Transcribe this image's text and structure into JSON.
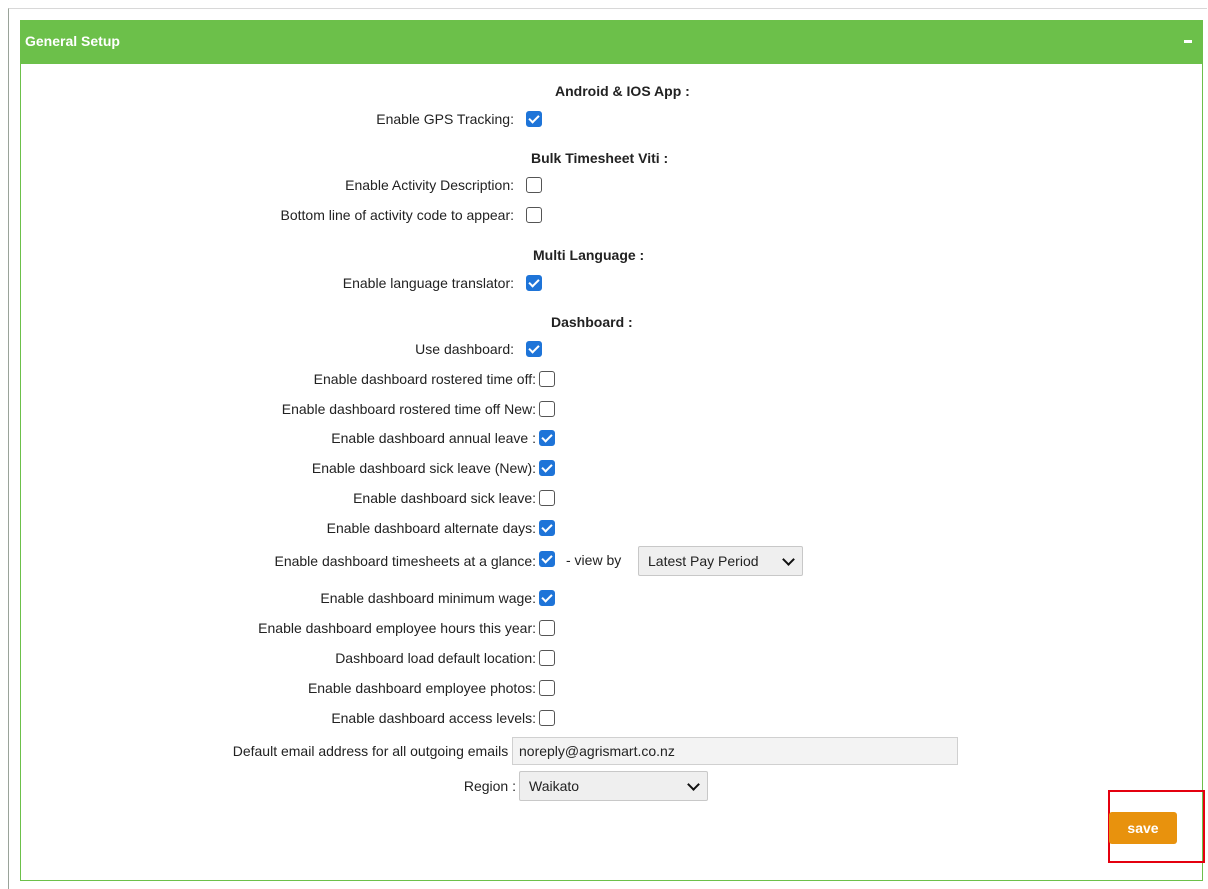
{
  "panel": {
    "title": "General Setup",
    "collapse": "−"
  },
  "sections": {
    "app": "Android & IOS App :",
    "bulk": "Bulk Timesheet Viti :",
    "language": "Multi Language :",
    "dashboard": "Dashboard :"
  },
  "fields": {
    "gps": {
      "label": "Enable GPS Tracking:",
      "checked": true
    },
    "activity_desc": {
      "label": "Enable Activity Description:",
      "checked": false
    },
    "bottom_line": {
      "label": "Bottom line of activity code to appear:",
      "checked": false
    },
    "translator": {
      "label": "Enable language translator:",
      "checked": true
    },
    "use_dashboard": {
      "label": "Use dashboard:",
      "checked": true
    },
    "rostered": {
      "label": "Enable dashboard rostered time off:",
      "checked": false
    },
    "rostered_new": {
      "label": "Enable dashboard rostered time off New:",
      "checked": false
    },
    "annual": {
      "label": "Enable dashboard annual leave :",
      "checked": true
    },
    "sick_new": {
      "label": "Enable dashboard sick leave (New):",
      "checked": true
    },
    "sick": {
      "label": "Enable dashboard sick leave:",
      "checked": false
    },
    "alternate": {
      "label": "Enable dashboard alternate days:",
      "checked": true
    },
    "glance": {
      "label": "Enable dashboard timesheets at a glance:",
      "checked": true,
      "view_by_label": "- view by",
      "view_by_value": "Latest Pay Period"
    },
    "min_wage": {
      "label": "Enable dashboard minimum wage:",
      "checked": true
    },
    "emp_hours": {
      "label": "Enable dashboard employee hours this year:",
      "checked": false
    },
    "default_loc": {
      "label": "Dashboard load default location:",
      "checked": false
    },
    "emp_photos": {
      "label": "Enable dashboard employee photos:",
      "checked": false
    },
    "access_levels": {
      "label": "Enable dashboard access levels:",
      "checked": false
    },
    "email": {
      "label": "Default email address for all outgoing emails :",
      "value": "noreply@agrismart.co.nz"
    },
    "region": {
      "label": "Region :",
      "value": "Waikato"
    }
  },
  "save_label": "save",
  "colors": {
    "header": "#6cc04a",
    "checkbox_on": "#1e74d8",
    "save": "#e8920d",
    "highlight": "#e4000f"
  }
}
